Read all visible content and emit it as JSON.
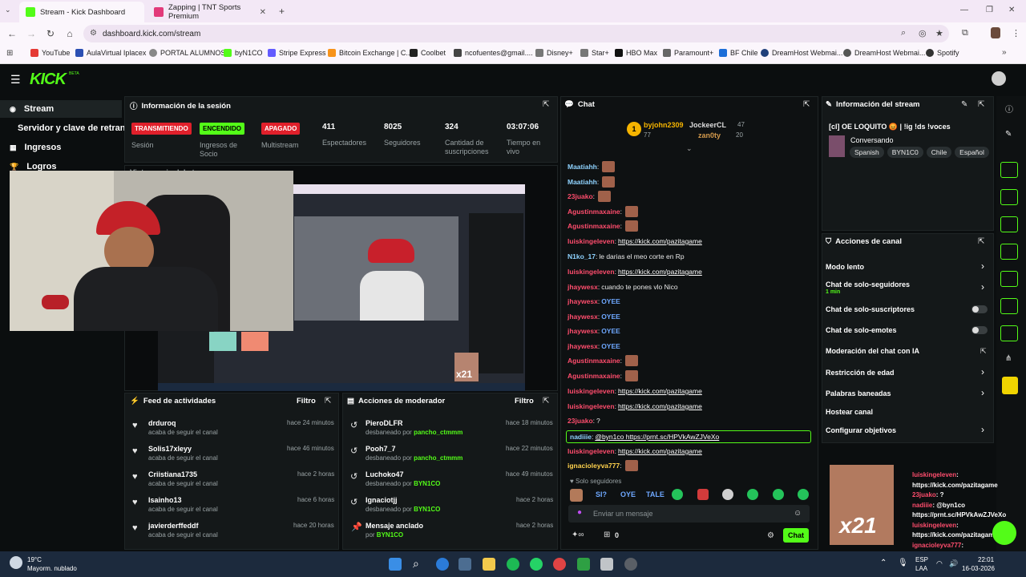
{
  "browser": {
    "tabs": [
      {
        "title": "Stream - Kick Dashboard",
        "active": true
      },
      {
        "title": "Zapping | TNT Sports Premium",
        "active": false
      }
    ],
    "url": "dashboard.kick.com/stream",
    "bookmarks": [
      "YouTube",
      "AulaVirtual Iplacex",
      "PORTAL ALUMNOS",
      "byN1CO",
      "Stripe Express",
      "Bitcoin Exchange | C...",
      "Coolbet",
      "ncofuentes@gmail....",
      "Disney+",
      "Star+",
      "HBO Max",
      "Paramount+",
      "BF Chile",
      "DreamHost Webmai...",
      "DreamHost Webmai...",
      "Spotify"
    ]
  },
  "app": {
    "logo": "KICK",
    "logo_badge": "BETA"
  },
  "nav": {
    "items": [
      "Stream",
      "Servidor y clave de retransm",
      "Ingresos",
      "Logros"
    ]
  },
  "session": {
    "title": "Información de la sesión",
    "badges": [
      {
        "label": "TRANSMITIENDO",
        "caption": "Sesión",
        "color": "#e0202b"
      },
      {
        "label": "ENCENDIDO",
        "caption": "Ingresos de Socio",
        "color": "#53fc18"
      },
      {
        "label": "APAGADO",
        "caption": "Multistream",
        "color": "#e0202b"
      }
    ],
    "stats": [
      {
        "value": "411",
        "label": "Espectadores"
      },
      {
        "value": "8025",
        "label": "Seguidores"
      },
      {
        "value": "324",
        "label": "Cantidad de suscripciones"
      },
      {
        "value": "03:07:06",
        "label": "Tiempo en vivo"
      }
    ]
  },
  "preview": {
    "title": "Vista previa del stream",
    "overlay": "x21"
  },
  "activity": {
    "title": "Feed de actividades",
    "filter": "Filtro",
    "items": [
      {
        "name": "drduroq",
        "sub": "acaba de seguir el canal",
        "time": "hace 24 minutos"
      },
      {
        "name": "Solis17xleyy",
        "sub": "acaba de seguir el canal",
        "time": "hace 46 minutos"
      },
      {
        "name": "Criistiana1735",
        "sub": "acaba de seguir el canal",
        "time": "hace 2 horas"
      },
      {
        "name": "Isainho13",
        "sub": "acaba de seguir el canal",
        "time": "hace 6 horas"
      },
      {
        "name": "javierderffeddf",
        "sub": "acaba de seguir el canal",
        "time": "hace 20 horas"
      }
    ]
  },
  "modactions": {
    "title": "Acciones de moderador",
    "filter": "Filtro",
    "items": [
      {
        "name": "PieroDLFR",
        "sub": "desbaneado por",
        "by": "pancho_ctmmm",
        "time": "hace 18 minutos"
      },
      {
        "name": "Pooh7_7",
        "sub": "desbaneado por",
        "by": "pancho_ctmmm",
        "time": "hace 22 minutos"
      },
      {
        "name": "Luchoko47",
        "sub": "desbaneado por",
        "by": "BYN1CO",
        "time": "hace 49 minutos"
      },
      {
        "name": "Ignaciotjj",
        "sub": "desbaneado por",
        "by": "BYN1CO",
        "time": "hace 2 horas"
      },
      {
        "name": "Mensaje anclado",
        "sub": "por",
        "by": "BYN1CO",
        "time": "hace 2 horas"
      }
    ]
  },
  "chat": {
    "title": "Chat",
    "top": [
      {
        "rank": "1",
        "name": "byjohn2309",
        "value": "77"
      },
      {
        "rank": "",
        "name": "JockeerCL",
        "value": "47"
      },
      {
        "rank": "",
        "name": "zan0ty",
        "value": "20"
      }
    ],
    "messages": [
      {
        "user": "Maatiahh",
        "color": "#8fd3ff",
        "text": ""
      },
      {
        "user": "Maatiahh",
        "color": "#8fd3ff",
        "text": ""
      },
      {
        "user": "23juako",
        "color": "#ff4d6d",
        "text": ""
      },
      {
        "user": "Agustinmaxaine",
        "color": "#ff4d6d",
        "text": ""
      },
      {
        "user": "Agustinmaxaine",
        "color": "#ff4d6d",
        "text": ""
      },
      {
        "user": "luiskingeleven",
        "color": "#ff4d6d",
        "text": "https://kick.com/pazitagame"
      },
      {
        "user": "N1ko_17",
        "color": "#8fd3ff",
        "text": "le darias el meo corte en Rp"
      },
      {
        "user": "luiskingeleven",
        "color": "#ff4d6d",
        "text": "https://kick.com/pazitagame"
      },
      {
        "user": "jhaywesx",
        "color": "#ff4d6d",
        "text": "cuando te pones vlo Nico"
      },
      {
        "user": "jhaywesx",
        "color": "#ff4d6d",
        "text": "OYEE"
      },
      {
        "user": "jhaywesx",
        "color": "#ff4d6d",
        "text": "OYEE"
      },
      {
        "user": "jhaywesx",
        "color": "#ff4d6d",
        "text": "OYEE"
      },
      {
        "user": "jhaywesx",
        "color": "#ff4d6d",
        "text": "OYEE"
      },
      {
        "user": "Agustinmaxaine",
        "color": "#ff4d6d",
        "text": ""
      },
      {
        "user": "Agustinmaxaine",
        "color": "#ff4d6d",
        "text": ""
      },
      {
        "user": "luiskingeleven",
        "color": "#ff4d6d",
        "text": "https://kick.com/pazitagame"
      },
      {
        "user": "luiskingeleven",
        "color": "#ff4d6d",
        "text": "https://kick.com/pazitagame"
      },
      {
        "user": "23juako",
        "color": "#ff4d6d",
        "text": "?"
      },
      {
        "user": "nadiiie",
        "color": "#8fd3ff",
        "text": "@byn1co https://prnt.sc/HPVkAwZJVeXo",
        "highlight": true
      },
      {
        "user": "luiskingeleven",
        "color": "#ff4d6d",
        "text": "https://kick.com/pazitagame"
      },
      {
        "user": "ignacioleyva777",
        "color": "#ffd24d",
        "text": ""
      }
    ],
    "mode_label": "Solo seguidores",
    "emote_labels": [
      "SI?",
      "OYE",
      "TALE"
    ],
    "input_placeholder": "Enviar un mensaje",
    "count": "0",
    "send_label": "Chat"
  },
  "streaminfo": {
    "title": "Información del stream",
    "stream_title": "[cl] OE LOQUITO 😡 | !ig !ds !voces",
    "category": "Conversando",
    "tags": [
      "Spanish",
      "BYN1C0",
      "Chile",
      "Español"
    ]
  },
  "channel": {
    "title": "Acciones de canal",
    "items": [
      {
        "label": "Modo lento",
        "type": "chevron"
      },
      {
        "label": "Chat de solo-seguidores",
        "sub": "1 min",
        "type": "chevron"
      },
      {
        "label": "Chat de solo-suscriptores",
        "type": "toggle"
      },
      {
        "label": "Chat de solo-emotes",
        "type": "toggle"
      },
      {
        "label": "Moderación del chat con IA",
        "type": "external"
      },
      {
        "label": "Restricción de edad",
        "type": "chevron"
      },
      {
        "label": "Palabras baneadas",
        "type": "chevron"
      },
      {
        "label": "Hostear canal",
        "type": "none"
      },
      {
        "label": "Configurar objetivos",
        "type": "chevron"
      }
    ]
  },
  "overlay_chat": {
    "label": "x21",
    "lines": [
      {
        "user": "luiskingeleven",
        "text": ":"
      },
      {
        "user": "",
        "text": "https://kick.com/pazitagame"
      },
      {
        "user": "23juako",
        "text": ": ?"
      },
      {
        "user": "nadiiie",
        "text": ": @byn1co"
      },
      {
        "user": "",
        "text": "https://prnt.sc/HPVkAwZJVeXo"
      },
      {
        "user": "luiskingeleven",
        "text": ":"
      },
      {
        "user": "",
        "text": "https://kick.com/pazitagame"
      },
      {
        "user": "ignacioleyva777",
        "text": ":"
      }
    ]
  },
  "taskbar": {
    "weather_temp": "19°C",
    "weather_desc": "Mayorm. nublado",
    "lang": "ESP",
    "layout": "LAA",
    "time": "22:01",
    "date": "16-03-2026"
  }
}
